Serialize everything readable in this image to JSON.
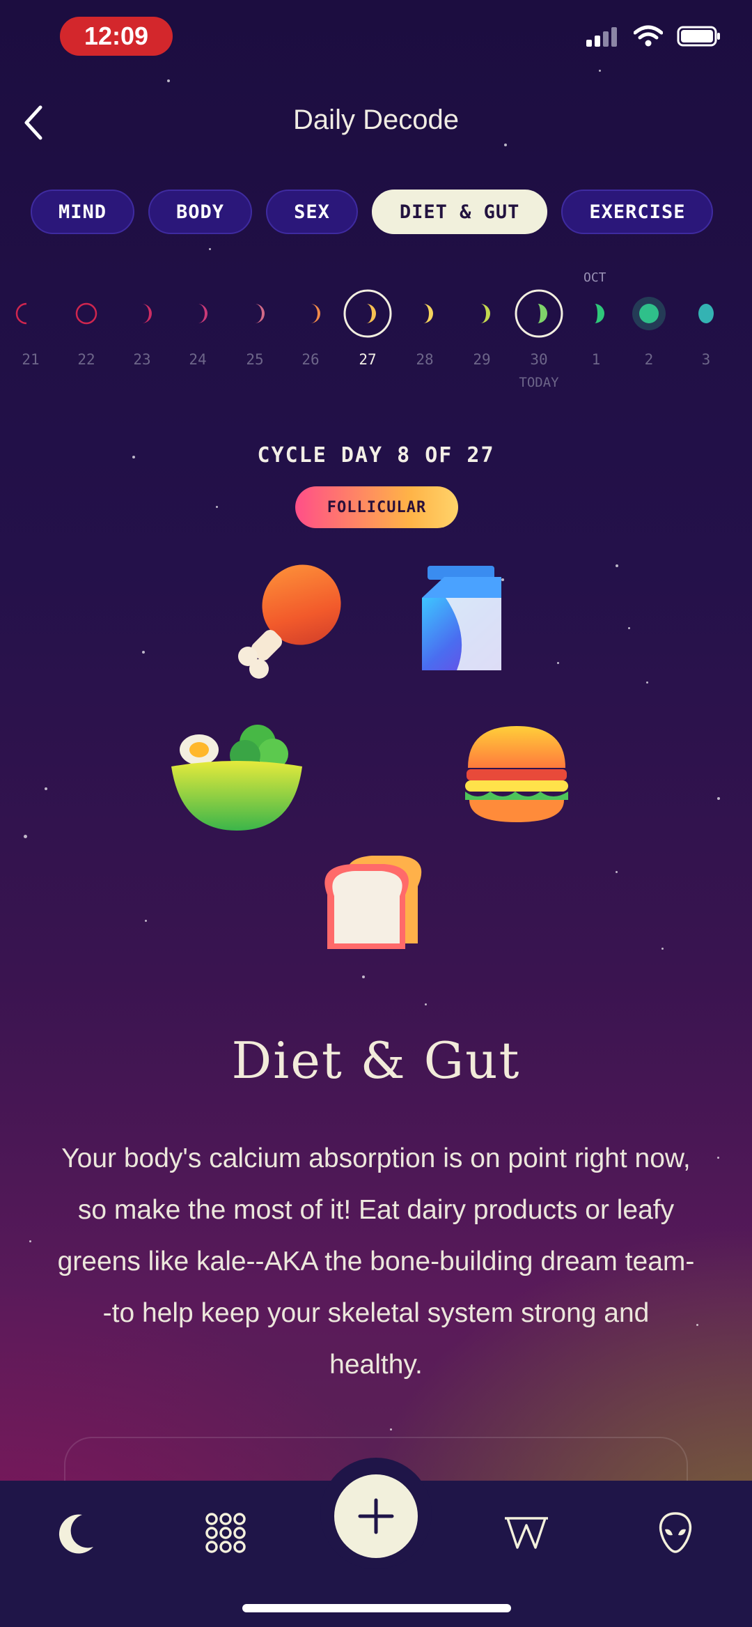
{
  "status_bar": {
    "time": "12:09"
  },
  "header": {
    "title": "Daily Decode"
  },
  "tabs": [
    {
      "label": "MIND"
    },
    {
      "label": "BODY"
    },
    {
      "label": "SEX"
    },
    {
      "label": "DIET & GUT",
      "active": true
    },
    {
      "label": "EXERCISE"
    }
  ],
  "calendar": {
    "month_label": "OCT",
    "today_label": "TODAY",
    "days": [
      {
        "num": "21",
        "moon": "thin-crescent-left",
        "color": "#d0264f"
      },
      {
        "num": "22",
        "moon": "new-moon-ring",
        "color": "#d0264f"
      },
      {
        "num": "23",
        "moon": "thin-crescent",
        "color": "#cc2d63"
      },
      {
        "num": "24",
        "moon": "thin-crescent",
        "color": "#c93a78"
      },
      {
        "num": "25",
        "moon": "thin-crescent",
        "color": "#d26a87"
      },
      {
        "num": "26",
        "moon": "thin-crescent",
        "color": "#f08a4a"
      },
      {
        "num": "27",
        "moon": "crescent",
        "color": "#f7c052",
        "selected": true
      },
      {
        "num": "28",
        "moon": "crescent",
        "color": "#f4d35e"
      },
      {
        "num": "29",
        "moon": "crescent",
        "color": "#c4d850"
      },
      {
        "num": "30",
        "moon": "half",
        "color": "#7fd36a",
        "today": true
      },
      {
        "num": "1",
        "moon": "half",
        "color": "#2fc77a"
      },
      {
        "num": "2",
        "moon": "full-glow",
        "color": "#2fc08a"
      },
      {
        "num": "3",
        "moon": "gibbous",
        "color": "#34b3b3"
      }
    ]
  },
  "cycle": {
    "day_text": "CYCLE DAY 8 OF 27",
    "phase": "FOLLICULAR"
  },
  "foods": [
    "drumstick-icon",
    "milk-carton-icon",
    "salad-bowl-icon",
    "burger-icon",
    "bread-icon"
  ],
  "section": {
    "title": "Diet & Gut",
    "body": "Your body's calcium absorption is on point right now, so make the most of it! Eat dairy products or leafy greens like kale--AKA the bone-building dream team--to help keep your skeletal system strong and healthy."
  },
  "bottom_nav": [
    "moon-icon",
    "grid-icon",
    "add-icon",
    "wiki-icon",
    "alien-icon"
  ]
}
